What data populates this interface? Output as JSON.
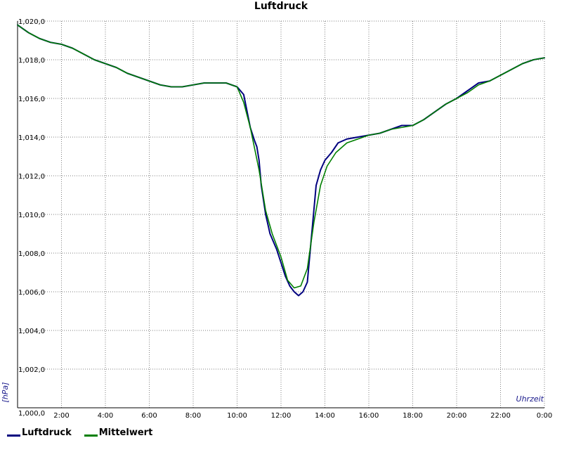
{
  "chart_data": {
    "type": "line",
    "title": "Luftdruck",
    "xlabel": "Uhrzeit",
    "ylabel": "[hPa]",
    "xlim": [
      0,
      24
    ],
    "ylim": [
      1000,
      1020
    ],
    "x_tick_labels": [
      "2:00",
      "4:00",
      "6:00",
      "8:00",
      "10:00",
      "12:00",
      "14:00",
      "16:00",
      "18:00",
      "20:00",
      "22:00",
      "0:00"
    ],
    "y_tick_labels": [
      "1,000,0",
      "1,002,0",
      "1,004,0",
      "1,006,0",
      "1,008,0",
      "1,010,0",
      "1,012,0",
      "1,014,0",
      "1,016,0",
      "1,018,0",
      "1,020,0"
    ],
    "grid": true,
    "legend_position": "bottom-left",
    "series": [
      {
        "name": "Luftdruck",
        "color": "#00007f",
        "x": [
          0,
          0.5,
          1,
          1.5,
          2,
          2.5,
          3,
          3.5,
          4,
          4.5,
          5,
          5.5,
          6,
          6.5,
          7,
          7.5,
          8,
          8.5,
          9,
          9.5,
          10,
          10.3,
          10.6,
          10.8,
          10.9,
          11,
          11.1,
          11.3,
          11.5,
          11.8,
          12,
          12.2,
          12.4,
          12.6,
          12.8,
          13,
          13.2,
          13.4,
          13.6,
          13.8,
          14,
          14.3,
          14.6,
          15,
          15.5,
          16,
          16.5,
          17,
          17.5,
          18,
          18.5,
          19,
          19.5,
          20,
          20.5,
          21,
          21.5,
          22,
          22.5,
          23,
          23.5,
          24
        ],
        "values": [
          1019.8,
          1019.4,
          1019.1,
          1018.9,
          1018.8,
          1018.6,
          1018.3,
          1018.0,
          1017.8,
          1017.6,
          1017.3,
          1017.1,
          1016.9,
          1016.7,
          1016.6,
          1016.6,
          1016.7,
          1016.8,
          1016.8,
          1016.8,
          1016.6,
          1016.2,
          1014.5,
          1013.8,
          1013.5,
          1012.8,
          1011.5,
          1010.0,
          1009.0,
          1008.2,
          1007.5,
          1006.8,
          1006.3,
          1006.0,
          1005.8,
          1006.0,
          1006.5,
          1009.0,
          1011.5,
          1012.3,
          1012.8,
          1013.2,
          1013.7,
          1013.9,
          1014.0,
          1014.1,
          1014.2,
          1014.4,
          1014.6,
          1014.6,
          1014.9,
          1015.3,
          1015.7,
          1016.0,
          1016.4,
          1016.8,
          1016.9,
          1017.2,
          1017.5,
          1017.8,
          1018.0,
          1018.1
        ]
      },
      {
        "name": "Mittelwert",
        "color": "#007f00",
        "x": [
          0,
          0.5,
          1,
          1.5,
          2,
          2.5,
          3,
          3.5,
          4,
          4.5,
          5,
          5.5,
          6,
          6.5,
          7,
          7.5,
          8,
          8.5,
          9,
          9.5,
          10,
          10.3,
          10.6,
          11,
          11.3,
          11.6,
          12,
          12.3,
          12.6,
          12.9,
          13.2,
          13.5,
          13.8,
          14.1,
          14.5,
          15,
          15.5,
          16,
          16.5,
          17,
          17.5,
          18,
          18.5,
          19,
          19.5,
          20,
          20.5,
          21,
          21.5,
          22,
          22.5,
          23,
          23.5,
          24
        ],
        "values": [
          1019.8,
          1019.4,
          1019.1,
          1018.9,
          1018.8,
          1018.6,
          1018.3,
          1018.0,
          1017.8,
          1017.6,
          1017.3,
          1017.1,
          1016.9,
          1016.7,
          1016.6,
          1016.6,
          1016.7,
          1016.8,
          1016.8,
          1016.8,
          1016.6,
          1015.8,
          1014.5,
          1012.3,
          1010.2,
          1009.0,
          1007.8,
          1006.6,
          1006.2,
          1006.3,
          1007.2,
          1009.6,
          1011.5,
          1012.5,
          1013.2,
          1013.7,
          1013.9,
          1014.1,
          1014.2,
          1014.4,
          1014.5,
          1014.6,
          1014.9,
          1015.3,
          1015.7,
          1016.0,
          1016.3,
          1016.7,
          1016.9,
          1017.2,
          1017.5,
          1017.8,
          1018.0,
          1018.1
        ]
      }
    ]
  }
}
